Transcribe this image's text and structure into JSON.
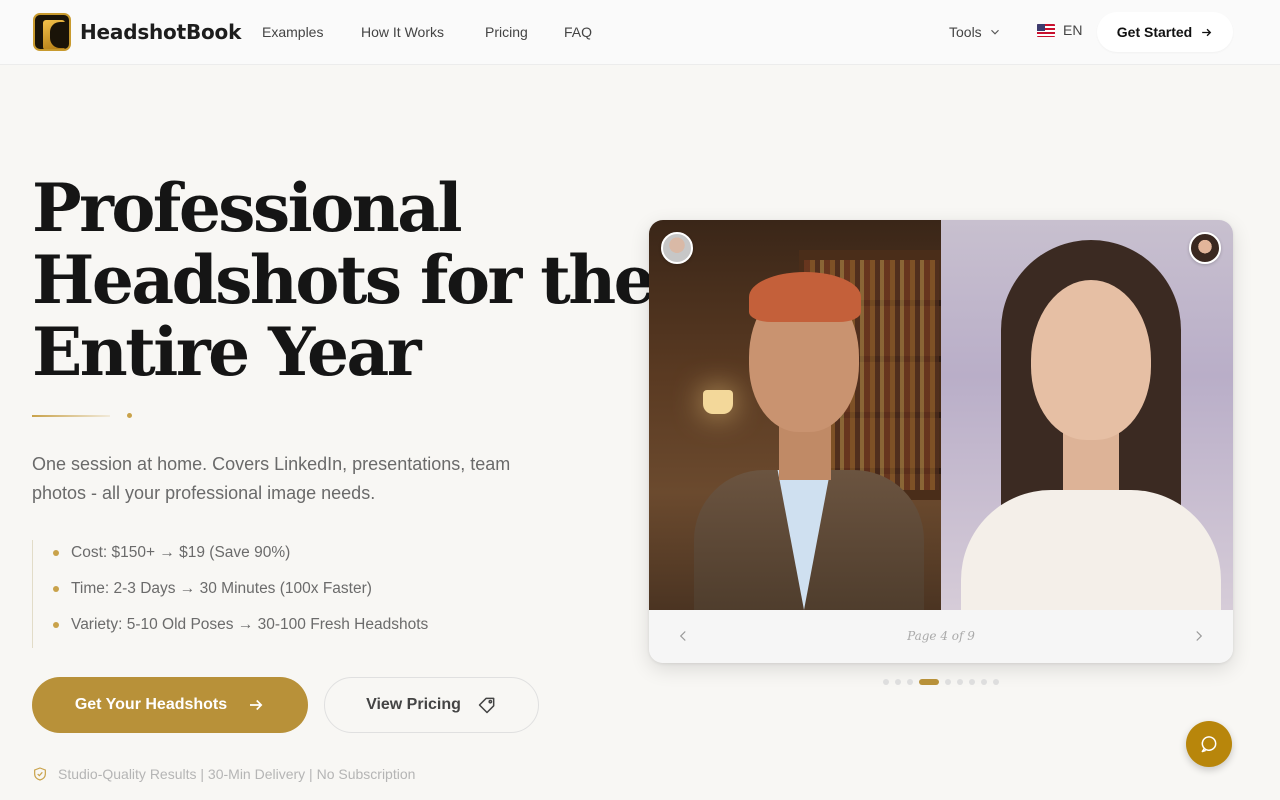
{
  "header": {
    "brand": "HeadshotBook",
    "nav": [
      "Examples",
      "How It Works",
      "Pricing",
      "FAQ"
    ],
    "tools_label": "Tools",
    "lang": "EN",
    "cta": "Get Started"
  },
  "hero": {
    "title_lines": [
      "Professional",
      "Headshots for the",
      "Entire Year"
    ],
    "subtitle": "One session at home. Covers LinkedIn, presentations, team photos - all your professional image needs.",
    "bullets": [
      "Cost: $150+ → $19 (Save 90%)",
      "Time: 2-3 Days → 30 Minutes (100x Faster)",
      "Variety: 5-10 Old Poses → 30-100 Fresh Headshots"
    ],
    "primary_button": "Get Your Headshots",
    "secondary_button": "View Pricing",
    "trust_line": "Studio-Quality Results | 30-Min Delivery | No Subscription"
  },
  "carousel": {
    "page_indicator": "Page 4 of 9",
    "current_page": 4,
    "total_pages": 9
  },
  "colors": {
    "accent": "#b89139",
    "chat": "#b8860b"
  },
  "icons": {
    "logo": "headshotbook-logo",
    "tools_chevron": "chevron-down-icon",
    "cta_arrow": "arrow-right-icon",
    "tag": "tag-icon",
    "shield": "shield-check-icon",
    "chat": "chat-bubble-icon"
  }
}
